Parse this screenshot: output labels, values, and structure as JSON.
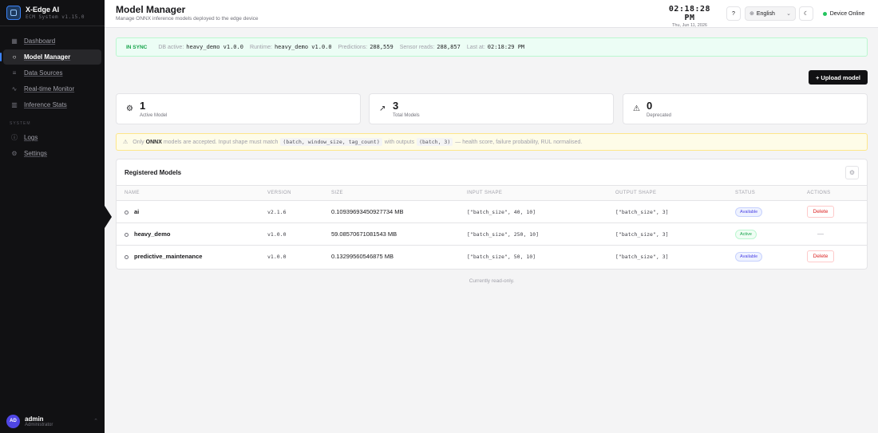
{
  "brand": {
    "title": "X-Edge AI",
    "subtitle": "ECM System v1.15.0"
  },
  "sidebar": {
    "items": [
      {
        "label": "Dashboard",
        "icon": "grid-icon"
      },
      {
        "label": "Model Manager",
        "icon": "circle-icon"
      },
      {
        "label": "Data Sources",
        "icon": "database-icon"
      },
      {
        "label": "Real-time Monitor",
        "icon": "activity-icon"
      },
      {
        "label": "Inference Stats",
        "icon": "bar-chart-icon"
      }
    ],
    "section_label": "SYSTEM",
    "system_items": [
      {
        "label": "Logs",
        "icon": "info-icon"
      },
      {
        "label": "Settings",
        "icon": "gear-icon"
      }
    ]
  },
  "user": {
    "initials": "AD",
    "name": "admin",
    "role": "Administrator"
  },
  "header": {
    "title": "Model Manager",
    "subtitle": "Manage ONNX inference models deployed to the edge device",
    "time": "02:18:28 PM",
    "date": "Thu, Jun 11, 2026",
    "help_label": "?",
    "language": "English",
    "device_status": "Device Online"
  },
  "sync": {
    "badge": "IN SYNC",
    "db_label": "DB active:",
    "db_value": "heavy_demo v1.0.0",
    "runtime_label": "Runtime:",
    "runtime_value": "heavy_demo v1.0.0",
    "predictions_label": "Predictions:",
    "predictions_value": "288,559",
    "sensor_label": "Sensor reads:",
    "sensor_value": "288,857",
    "last_label": "Last at:",
    "last_value": "02:18:29 PM"
  },
  "upload_label": "+ Upload model",
  "stats": [
    {
      "value": "1",
      "label": "Active Model",
      "icon": "gear-icon"
    },
    {
      "value": "3",
      "label": "Total Models",
      "icon": "trending-up-icon"
    },
    {
      "value": "0",
      "label": "Deprecated",
      "icon": "warning-icon"
    }
  ],
  "notice": {
    "part1": "Only",
    "format": "ONNX",
    "part2": "models are accepted. Input shape must match",
    "input_shape": "(batch, window_size, tag_count)",
    "part3": "with outputs",
    "output_shape": "(batch, 3)",
    "part4": "— health score, failure probability, RUL normalised."
  },
  "table": {
    "title": "Registered Models",
    "headers": [
      "NAME",
      "VERSION",
      "SIZE",
      "INPUT SHAPE",
      "OUTPUT SHAPE",
      "STATUS",
      "ACTIONS"
    ],
    "rows": [
      {
        "name": "ai",
        "version": "v2.1.6",
        "size": "0.10939693450927734 MB",
        "input": "[\"batch_size\", 40, 10]",
        "output": "[\"batch_size\", 3]",
        "status": "Available",
        "action": "Delete"
      },
      {
        "name": "heavy_demo",
        "version": "v1.0.0",
        "size": "59.08570671081543 MB",
        "input": "[\"batch_size\", 250, 10]",
        "output": "[\"batch_size\", 3]",
        "status": "Active",
        "action": "—"
      },
      {
        "name": "predictive_maintenance",
        "version": "v1.0.0",
        "size": "0.13299560546875 MB",
        "input": "[\"batch_size\", 50, 10]",
        "output": "[\"batch_size\", 3]",
        "status": "Available",
        "action": "Delete"
      }
    ]
  },
  "footer_note": "Currently read-only."
}
